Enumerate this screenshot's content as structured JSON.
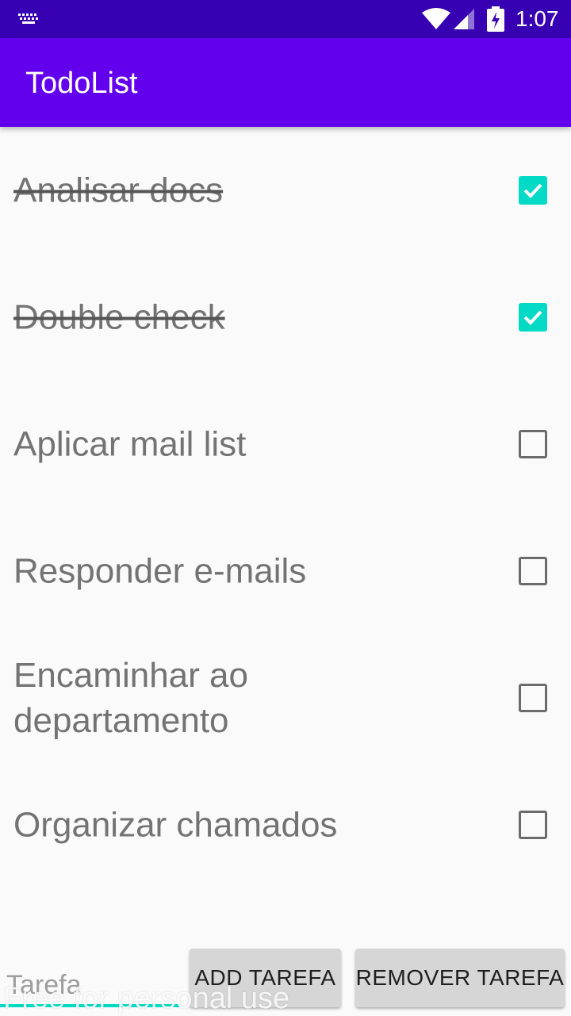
{
  "status_bar": {
    "time": "1:07",
    "icons": [
      "keyboard-icon",
      "wifi-icon",
      "cell-signal-icon",
      "battery-charging-icon"
    ]
  },
  "app_bar": {
    "title": "TodoList"
  },
  "tasks": [
    {
      "label": "Analisar docs",
      "checked": true
    },
    {
      "label": "Double check",
      "checked": true
    },
    {
      "label": "Aplicar mail list",
      "checked": false
    },
    {
      "label": "Responder e-mails",
      "checked": false
    },
    {
      "label": "Encaminhar ao departamento",
      "checked": false
    },
    {
      "label": "Organizar chamados",
      "checked": false
    }
  ],
  "bottom_bar": {
    "input_placeholder": "Tarefa",
    "input_value": "",
    "add_label": "ADD TAREFA",
    "remove_label": "REMOVER TAREFA"
  },
  "watermark": "Free for personal use",
  "colors": {
    "status_bar": "#3700b3",
    "app_bar": "#6200ee",
    "accent": "#03dac5"
  }
}
